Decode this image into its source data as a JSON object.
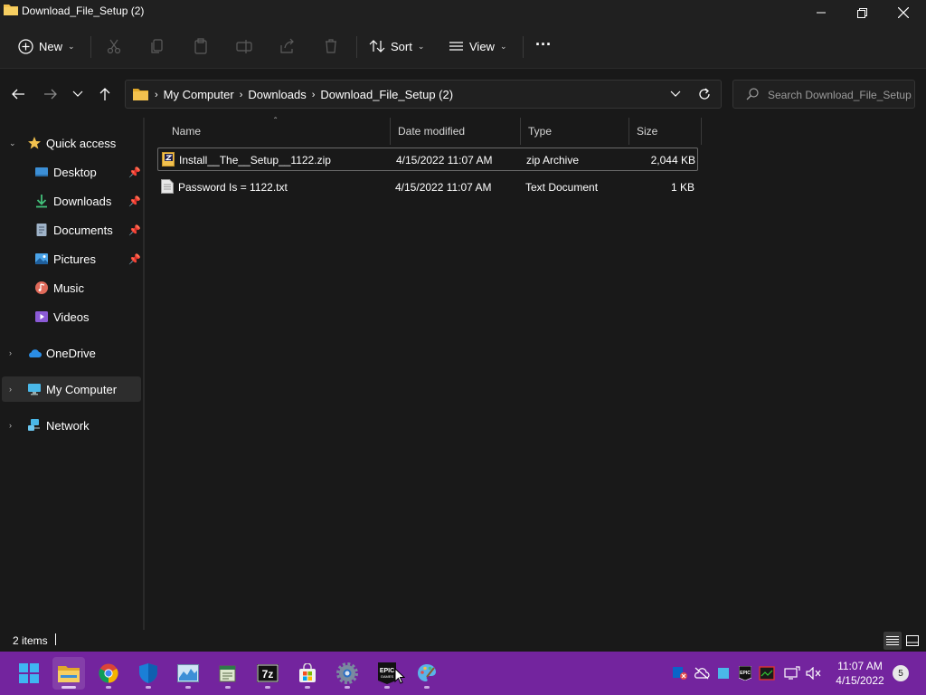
{
  "window": {
    "title": "Download_File_Setup (2)"
  },
  "toolbar": {
    "new_label": "New",
    "sort_label": "Sort",
    "view_label": "View",
    "more_label": "···"
  },
  "address": {
    "crumbs": [
      "My Computer",
      "Downloads",
      "Download_File_Setup (2)"
    ],
    "search_placeholder": "Search Download_File_Setup..."
  },
  "sidebar": {
    "quick_access": "Quick access",
    "items": [
      {
        "label": "Desktop",
        "icon": "desktop-icon",
        "pinned": true
      },
      {
        "label": "Downloads",
        "icon": "downloads-icon",
        "pinned": true
      },
      {
        "label": "Documents",
        "icon": "documents-icon",
        "pinned": true
      },
      {
        "label": "Pictures",
        "icon": "pictures-icon",
        "pinned": true
      },
      {
        "label": "Music",
        "icon": "music-icon",
        "pinned": false
      },
      {
        "label": "Videos",
        "icon": "videos-icon",
        "pinned": false
      }
    ],
    "onedrive": "OneDrive",
    "my_computer": "My Computer",
    "network": "Network"
  },
  "columns": {
    "name": "Name",
    "date": "Date modified",
    "type": "Type",
    "size": "Size"
  },
  "files": [
    {
      "name": "Install__The__Setup__1122.zip",
      "date": "4/15/2022 11:07 AM",
      "type": "zip Archive",
      "size": "2,044 KB",
      "icon": "zip-file-icon"
    },
    {
      "name": "Password Is =   1122.txt",
      "date": "4/15/2022 11:07 AM",
      "type": "Text Document",
      "size": "1 KB",
      "icon": "text-file-icon"
    }
  ],
  "status": {
    "item_count": "2 items"
  },
  "taskbar": {
    "clock_time": "11:07 AM",
    "clock_date": "4/15/2022",
    "notification_count": "5",
    "apps": [
      "start",
      "file-explorer",
      "chrome",
      "windows-security",
      "task-manager",
      "notepad",
      "7zip",
      "microsoft-store",
      "settings",
      "epic-games",
      "paint"
    ]
  },
  "colors": {
    "taskbar": "#73249e",
    "window_bg": "#191919",
    "chrome_bg": "#202020",
    "folder_yellow": "#f2c14e"
  }
}
